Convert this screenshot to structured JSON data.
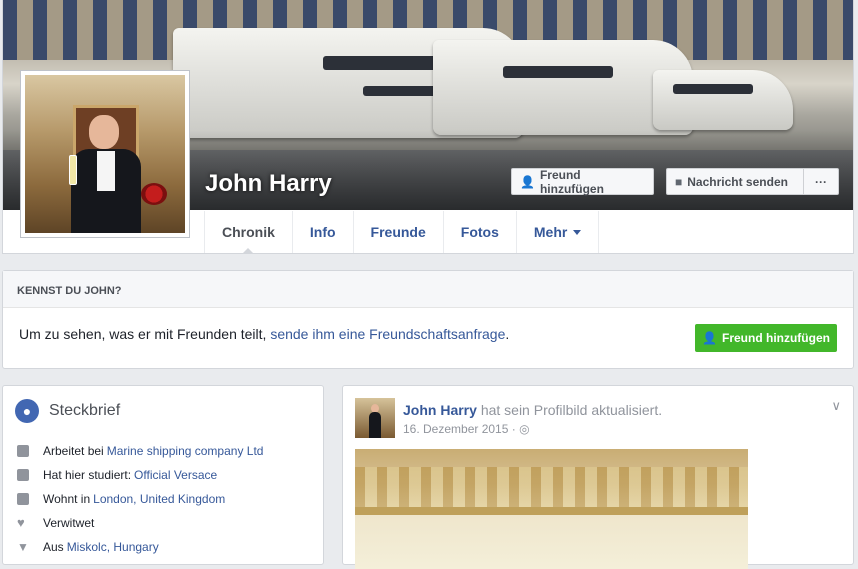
{
  "profile": {
    "name": "John Harry",
    "add_friend_label": "Freund hinzufügen",
    "message_label": "Nachricht senden",
    "more_label": "···"
  },
  "tabs": [
    "Chronik",
    "Info",
    "Freunde",
    "Fotos",
    "Mehr"
  ],
  "know_box": {
    "header": "KENNST DU JOHN?",
    "text_prefix": "Um zu sehen, was er mit Freunden teilt, ",
    "text_link": "sende ihm eine Freundschaftsanfrage",
    "text_suffix": ".",
    "button_label": "Freund hinzufügen"
  },
  "intro": {
    "title": "Steckbrief",
    "items": [
      {
        "icon": "briefcase-icon",
        "prefix": "Arbeitet bei",
        "link": "Marine shipping company Ltd"
      },
      {
        "icon": "graduation-cap-icon",
        "prefix": "Hat hier studiert:",
        "link": "Official Versace"
      },
      {
        "icon": "home-icon",
        "prefix": "Wohnt in",
        "link": "London, United Kingdom"
      },
      {
        "icon": "heart-icon",
        "prefix": "Verwitwet",
        "link": ""
      },
      {
        "icon": "location-pin-icon",
        "prefix": "Aus",
        "link": "Miskolc, Hungary"
      }
    ]
  },
  "post": {
    "author": "John Harry",
    "action": "hat sein Profilbild aktualisiert.",
    "date": "16. Dezember 2015 · "
  },
  "colors": {
    "link": "#365899",
    "green_button": "#42b72a",
    "background": "#e9ebee"
  }
}
